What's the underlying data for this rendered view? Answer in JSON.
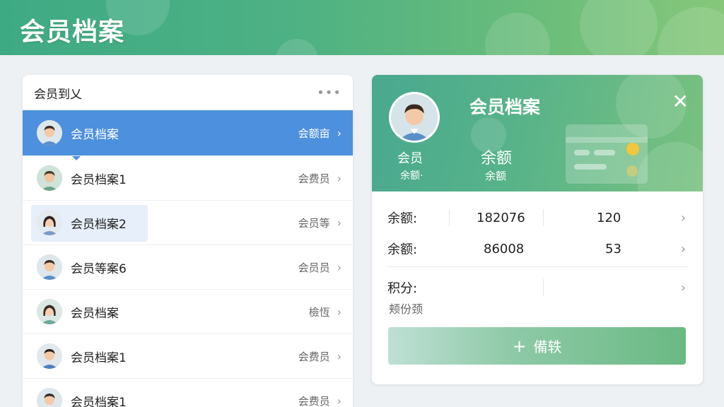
{
  "header": {
    "title": "会员档案"
  },
  "list": {
    "title": "会员到乂",
    "more_icon": "more-dots-icon",
    "items": [
      {
        "name": "会员档案",
        "tag": "会额亩",
        "selected": true,
        "avatar": "man"
      },
      {
        "name": "会员档案1",
        "tag": "会费员",
        "avatar": "man2"
      },
      {
        "name": "会员档案2",
        "tag": "会员等",
        "avatar": "woman",
        "highlighted": true
      },
      {
        "name": "会员等案6",
        "tag": "会员员",
        "avatar": "man"
      },
      {
        "name": "会员档案",
        "tag": "檢恆",
        "avatar": "woman2"
      },
      {
        "name": "会员档案1",
        "tag": "会费员",
        "avatar": "man3"
      },
      {
        "name": "会员档案1",
        "tag": "会费员",
        "avatar": "man"
      }
    ]
  },
  "detail": {
    "title": "会员档案",
    "close_icon": "close-icon",
    "avatar_label": "会员",
    "avatar_sub": "余额·",
    "balance_label": "余额",
    "balance_sub": "余额",
    "rows": [
      {
        "label": "余额:",
        "value1": "182076",
        "value2": "120"
      },
      {
        "label": "余额:",
        "value1": "86008",
        "value2": "53"
      },
      {
        "label": "积分:",
        "value1": "",
        "value2": ""
      }
    ],
    "note": "颊份颈",
    "action_label": "備轶",
    "colors": {
      "accent": "#4d90de",
      "brand": "#4db184"
    }
  }
}
